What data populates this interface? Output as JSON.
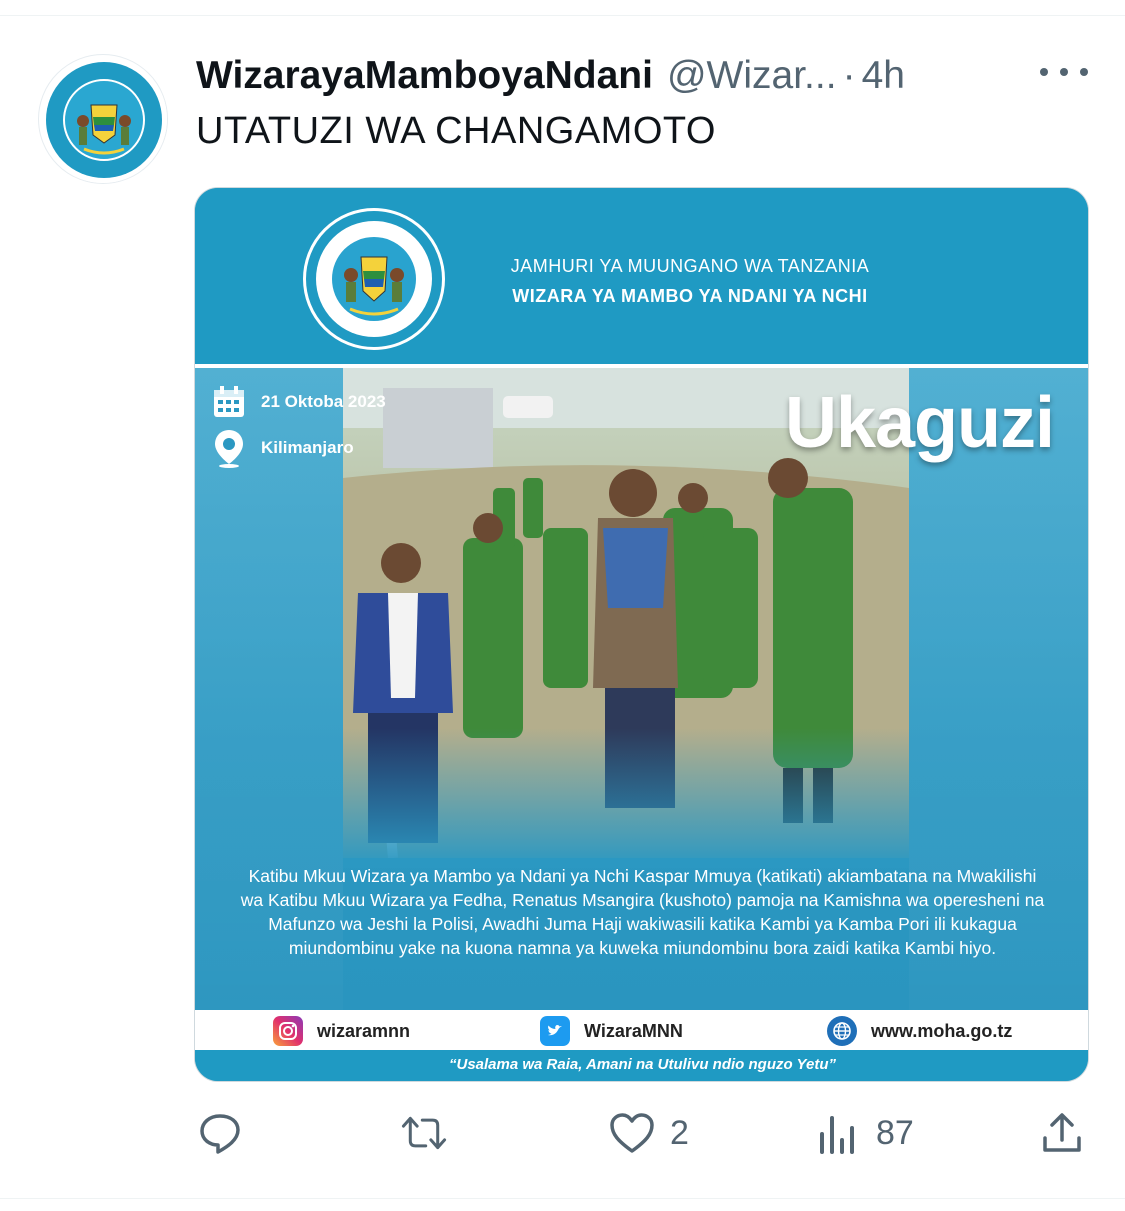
{
  "tweet": {
    "display_name": "WizarayaMamboyaNdani",
    "handle": "@Wizar...",
    "separator": "·",
    "time": "4h",
    "text": "UTATUZI WA CHANGAMOTO",
    "avatar_text": "WIZARA YA MAMBO YA NDANI YA NCHI"
  },
  "poster": {
    "emblem_text": "WIZARA YA MAMBO YA NDANI YA NCHI",
    "government": "JAMHURI YA MUUNGANO WA TANZANIA",
    "ministry": "WIZARA YA MAMBO YA NDANI YA NCHI",
    "date": "21 Oktoba 2023",
    "location": "Kilimanjaro",
    "heading": "Ukaguzi",
    "caption": "Katibu Mkuu Wizara ya Mambo ya Ndani ya Nchi Kaspar Mmuya (katikati) akiambatana na Mwakilishi wa Katibu Mkuu Wizara ya Fedha, Renatus Msangira (kushoto) pamoja na Kamishna wa operesheni na Mafunzo wa Jeshi la Polisi, Awadhi Juma Haji wakiwasili katika Kambi ya Kamba Pori ili kukagua miundombinu yake na kuona namna ya kuweka miundombinu bora zaidi katika Kambi hiyo.",
    "instagram": "wizaramnn",
    "twitter": "WizaraMNN",
    "website": "www.moha.go.tz",
    "slogan": "“Usalama wa Raia, Amani na Utulivu ndio nguzo Yetu”"
  },
  "actions": {
    "reply_icon": "reply-icon",
    "retweet_icon": "retweet-icon",
    "like_icon": "heart-icon",
    "likes": "2",
    "views_icon": "views-icon",
    "views": "87",
    "share_icon": "share-icon"
  },
  "colors": {
    "poster_blue": "#1f9ac3",
    "secondary_text": "#536471",
    "primary_text": "#0f1419",
    "uniform_green": "#3f8a3a"
  }
}
